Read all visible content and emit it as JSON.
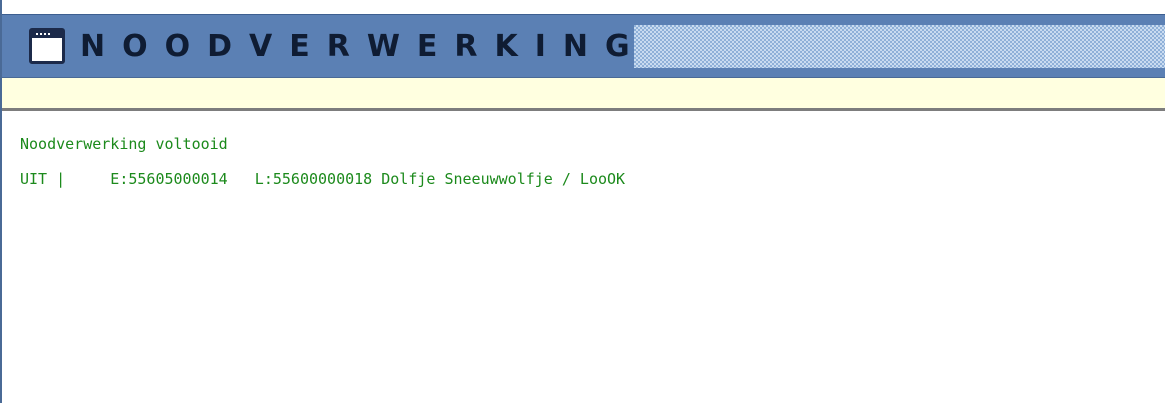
{
  "window": {
    "title": "NOODVERWERKING",
    "icon": "window-icon"
  },
  "infobar": {
    "text": ""
  },
  "console": {
    "lines": [
      "Noodverwerking voltooid",
      "UIT |     E:55605000014   L:55600000018 Dolfje Sneeuwwolfje / LooOK"
    ]
  },
  "colors": {
    "titlebar": "#5b80b4",
    "title_text": "#0f1c33",
    "infobar": "#ffffe0",
    "console_text": "#1c8a1c"
  }
}
